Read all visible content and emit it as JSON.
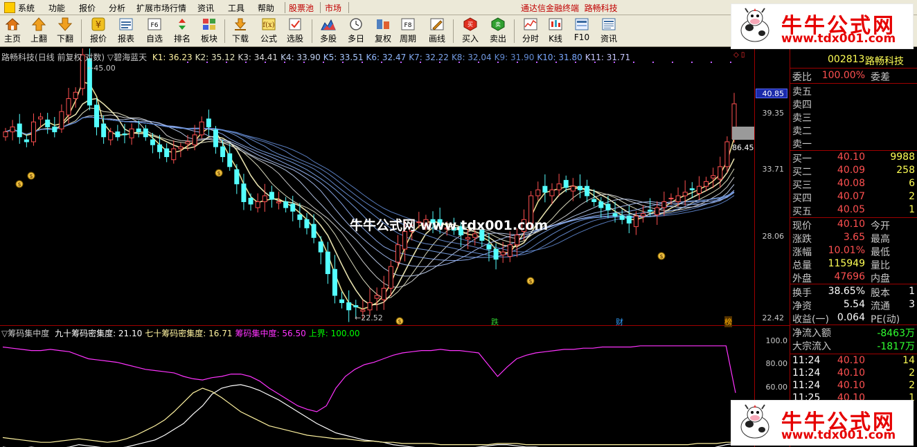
{
  "menubar": {
    "items": [
      "系统",
      "功能",
      "报价",
      "分析",
      "扩展市场行情",
      "资讯",
      "工具",
      "帮助"
    ],
    "tabs": [
      "股票池",
      "市场"
    ],
    "app_title": "通达信金融终端",
    "stock_title": "路畅科技"
  },
  "toolbar": {
    "buttons": [
      "主页",
      "上翻",
      "下翻",
      "报价",
      "报表",
      "自选",
      "排名",
      "板块",
      "下载",
      "公式",
      "选股",
      "多股",
      "多日",
      "复权",
      "周期",
      "画线",
      "买入",
      "卖出",
      "分时",
      "K线",
      "F10",
      "资讯"
    ]
  },
  "watermark": {
    "title": "牛牛公式网",
    "url": "www.tdx001.com",
    "overlay": "牛牛公式网 www.tdx001.com"
  },
  "main_chart": {
    "stock_label": "路畅科技",
    "period_label": "(日线 前复权 对数)",
    "indicator_label": "▽碧海蓝天",
    "k_values": [
      {
        "name": "K1",
        "value": "36.23"
      },
      {
        "name": "K2",
        "value": "35.12"
      },
      {
        "name": "K3",
        "value": "34.41"
      },
      {
        "name": "K4",
        "value": "33.90"
      },
      {
        "name": "K5",
        "value": "33.51"
      },
      {
        "name": "K6",
        "value": "32.47"
      },
      {
        "name": "K7",
        "value": "32.22"
      },
      {
        "name": "K8",
        "value": "32.04"
      },
      {
        "name": "K9",
        "value": "31.90"
      },
      {
        "name": "K10",
        "value": "31.80"
      },
      {
        "name": "K11",
        "value": "31.71"
      }
    ],
    "high_label": "45.00",
    "low_label": "22.52",
    "right_label": "86.45",
    "marker_die": "跌",
    "marker_cai": "财",
    "marker_bang": "榜",
    "price_axis": [
      "40.85",
      "39.35",
      "33.71",
      "28.06",
      "22.42"
    ],
    "colors": {
      "up": "#ff5050",
      "down": "#54ffff",
      "ribbon_light": "#fff3a0",
      "ribbon_blue": "#7ab8ff",
      "purple": "#ff00ff"
    }
  },
  "indicator_chart": {
    "name": "▽筹码集中度",
    "items": [
      {
        "label": "九十筹码密集度:",
        "value": "21.10",
        "color": "#ffffff"
      },
      {
        "label": "七十筹码密集度:",
        "value": "16.71",
        "color": "#fff3a0"
      },
      {
        "label": "筹码集中度:",
        "value": "56.50",
        "color": "#ff33ff"
      },
      {
        "label": "上界:",
        "value": "100.00",
        "color": "#00ff00"
      }
    ],
    "axis": [
      "100.0",
      "80.00",
      "60.00"
    ]
  },
  "quote_panel": {
    "code": "002813",
    "name": "路畅科技",
    "wei_bi_label": "委比",
    "wei_bi": "100.00%",
    "wei_cha_label": "委差",
    "sells": [
      "卖五",
      "卖四",
      "卖三",
      "卖二",
      "卖一"
    ],
    "buys": [
      {
        "label": "买一",
        "price": "40.10",
        "vol": "9988"
      },
      {
        "label": "买二",
        "price": "40.09",
        "vol": "258"
      },
      {
        "label": "买三",
        "price": "40.08",
        "vol": "6"
      },
      {
        "label": "买四",
        "price": "40.07",
        "vol": "2"
      },
      {
        "label": "买五",
        "price": "40.05",
        "vol": "1"
      }
    ],
    "stats": [
      {
        "l1": "现价",
        "v1": "40.10",
        "l2": "今开",
        "v2": "",
        "color": "#ff5050"
      },
      {
        "l1": "涨跌",
        "v1": "3.65",
        "l2": "最高",
        "v2": "",
        "color": "#ff5050"
      },
      {
        "l1": "涨幅",
        "v1": "10.01%",
        "l2": "最低",
        "v2": "",
        "color": "#ff5050"
      },
      {
        "l1": "总量",
        "v1": "115949",
        "l2": "量比",
        "v2": "",
        "color": "#ffff55"
      },
      {
        "l1": "外盘",
        "v1": "47696",
        "l2": "内盘",
        "v2": "",
        "color": "#ff5050"
      }
    ],
    "stats2": [
      {
        "l1": "换手",
        "v1": "38.65%",
        "l2": "股本",
        "v2": "1",
        "color": "#ffffff"
      },
      {
        "l1": "净资",
        "v1": "5.54",
        "l2": "流通",
        "v2": "3",
        "color": "#ffffff"
      },
      {
        "l1": "收益(一)",
        "v1": "0.064",
        "l2": "PE(动)",
        "v2": "",
        "color": "#ffffff"
      }
    ],
    "flow": [
      {
        "label": "净流入额",
        "value": "-8463",
        "unit": "万"
      },
      {
        "label": "大宗流入",
        "value": "-1817",
        "unit": "万"
      }
    ],
    "ticks": [
      {
        "time": "11:24",
        "price": "40.10",
        "vol": "14"
      },
      {
        "time": "11:24",
        "price": "40.10",
        "vol": "2"
      },
      {
        "time": "11:24",
        "price": "40.10",
        "vol": "2"
      },
      {
        "time": "11:25",
        "price": "40.10",
        "vol": "1"
      }
    ]
  }
}
